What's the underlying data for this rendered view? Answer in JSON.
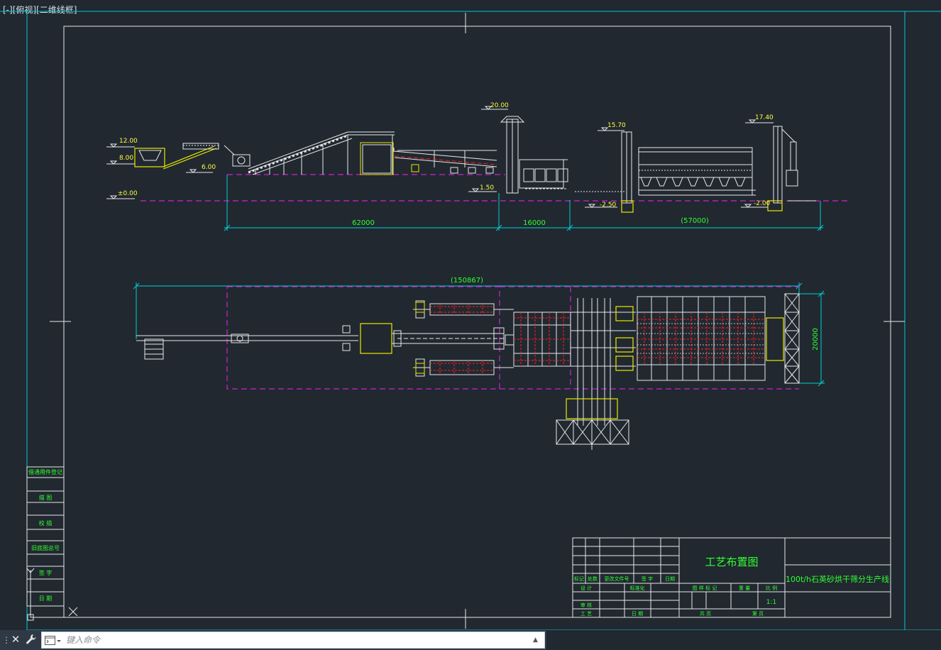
{
  "viewport": {
    "label": "[-][俯视][二维线框]"
  },
  "colors": {
    "background": "#212830",
    "frame": "#00c8d8",
    "border": "#e8e8e8",
    "dimension": "#00d0d0",
    "dim_text": "#30ff30",
    "elevation_text": "#ffff40",
    "equipment": "#e8e8e8",
    "equipment_yellow": "#e8e800",
    "red": "#ff2020",
    "magenta": "#cc22cc",
    "title_text": "#30ff30"
  },
  "elevations": {
    "e1200": "12.00",
    "e800": "8.00",
    "e600": "6.00",
    "e000": "±0.00",
    "e2000": "20.00",
    "e150": "1.50",
    "e1570": "15.70",
    "e250": "-2.50",
    "e1740": "17.40",
    "e200": "-2.00"
  },
  "dimensions": {
    "d62000": "62000",
    "d16000": "16000",
    "d57000": "(57000)",
    "d150867": "(150867)",
    "d20000": "20000"
  },
  "side_table": {
    "rows": [
      "借通用件登记",
      "描  图",
      "校  描",
      "旧底图总号",
      "签  字",
      "日  期"
    ]
  },
  "title_block": {
    "drawing_title": "工艺布置图",
    "project_title": "100t/h石英砂烘干筛分生产线",
    "rev_headers": [
      "标记",
      "处数",
      "更改文件号",
      "签 字",
      "日期"
    ],
    "role_design": "设 计",
    "role_standard": "标准化",
    "role_review": "审 核",
    "role_craft": "工 艺",
    "date_label": "日 期",
    "stage_mark": "图 样 标 记",
    "weight": "重 量",
    "scale_label": "比 例",
    "scale_value": "1:1",
    "total_sheets": "共    页",
    "sheet_no": "第    页"
  },
  "command_line": {
    "placeholder": "键入命令",
    "value": ""
  },
  "icons": {
    "ucs": "ucs-axis-icon",
    "close": "close-icon",
    "wrench": "wrench-icon",
    "prompt": "command-prompt-icon",
    "history": "chevron-up-icon"
  }
}
